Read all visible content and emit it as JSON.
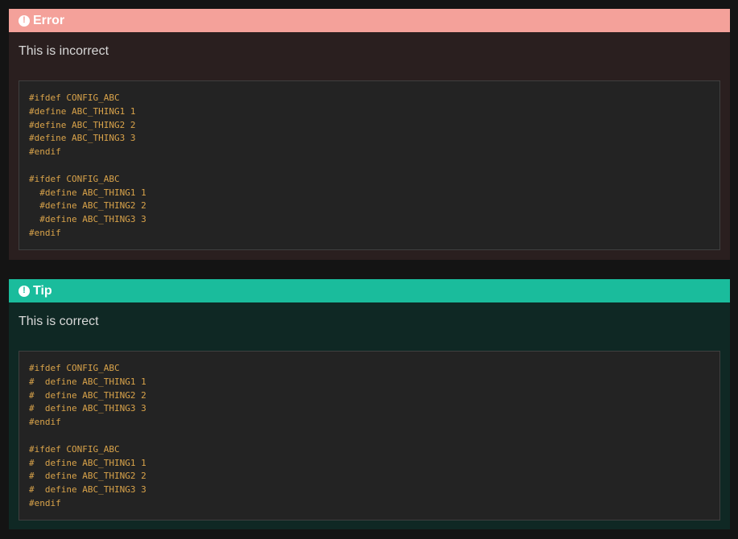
{
  "error_box": {
    "icon": "exclamation-circle-icon",
    "title": "Error",
    "text": "This is incorrect",
    "code_lines": [
      "#ifdef CONFIG_ABC",
      "#define ABC_THING1 1",
      "#define ABC_THING2 2",
      "#define ABC_THING3 3",
      "#endif",
      "",
      "#ifdef CONFIG_ABC",
      "  #define ABC_THING1 1",
      "  #define ABC_THING2 2",
      "  #define ABC_THING3 3",
      "#endif"
    ],
    "colors": {
      "header": "#f4a19a",
      "body": "#2a1f1f"
    }
  },
  "tip_box": {
    "icon": "exclamation-circle-icon",
    "title": "Tip",
    "text": "This is correct",
    "code_lines": [
      "#ifdef CONFIG_ABC",
      "#  define ABC_THING1 1",
      "#  define ABC_THING2 2",
      "#  define ABC_THING3 3",
      "#endif",
      "",
      "#ifdef CONFIG_ABC",
      "#  define ABC_THING1 1",
      "#  define ABC_THING2 2",
      "#  define ABC_THING3 3",
      "#endif"
    ],
    "colors": {
      "header": "#1abc9c",
      "body": "#0f2824"
    }
  },
  "code_color": "#d9a34a"
}
